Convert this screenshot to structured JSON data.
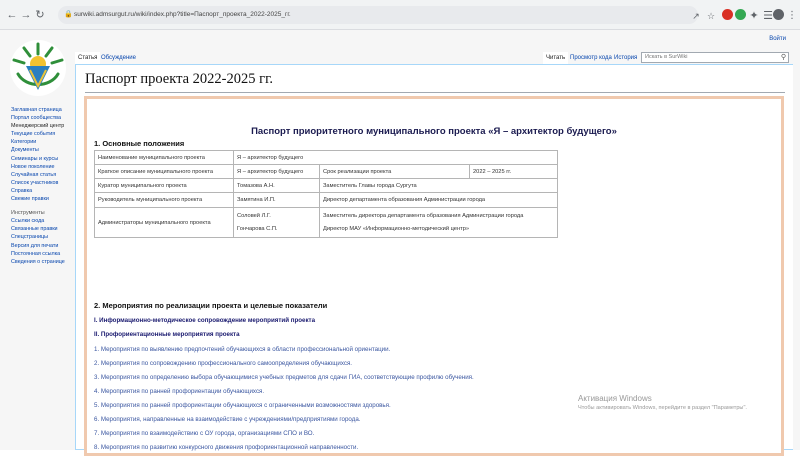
{
  "browser": {
    "url": "surwiki.admsurgut.ru/wiki/index.php?title=Паспорт_проекта_2022-2025_гг."
  },
  "top": {
    "login": "Войти"
  },
  "tabs": {
    "left": [
      "Статья",
      "Обсуждение"
    ],
    "right": [
      "Читать",
      "Просмотр кода",
      "История"
    ]
  },
  "search": {
    "placeholder": "Искать в SurWiki"
  },
  "sidebar": {
    "navigation": [
      "Заглавная страница",
      "Портал сообщества",
      "Менеджерский центр",
      "Текущие события",
      "Категории",
      "Документы",
      "Семинары и курсы",
      "Новое поколение",
      "Случайная статья",
      "Список участников",
      "Справка",
      "Свежие правки"
    ],
    "tools_header": "Инструменты",
    "tools": [
      "Ссылки сюда",
      "Связанные правки",
      "Спецстраницы",
      "Версия для печати",
      "Постоянная ссылка",
      "Сведения о странице"
    ]
  },
  "page": {
    "title": "Паспорт проекта 2022-2025 гг.",
    "doc_title": "Паспорт приоритетного муниципального проекта «Я – архитектор будущего»",
    "section1": "1. Основные положения",
    "table": {
      "r1": [
        "Наименование муниципального проекта",
        "Я – архитектор будущего"
      ],
      "r2": [
        "Краткое описание муниципального проекта",
        "Я – архитектор будущего",
        "Срок реализации проекта",
        "2022 – 2025 гг."
      ],
      "r3": [
        "Куратор муниципального проекта",
        "Томазова А.Н.",
        "Заместитель Главы города Сургута"
      ],
      "r4": [
        "Руководитель муниципального проекта",
        "Замятина И.П.",
        "Директор департамента образования Администрации города"
      ],
      "r5": [
        "Администраторы муниципального проекта",
        "Соловей Л.Г.",
        "Гончарова С.П.",
        "Заместитель директора департамента образования Администрации города",
        "Директор МАУ «Информационно-методический центр»"
      ]
    },
    "section2": "2. Мероприятия по реализации проекта и целевые показатели",
    "sub1": "I. Информационно-методическое сопровождение мероприятий проекта",
    "sub2": "II. Профориентационные мероприятия проекта",
    "items": [
      "1. Мероприятия по выявлению предпочтений обучающихся в области профессиональной ориентации.",
      "2. Мероприятия по сопровождению профессионального самоопределения обучающихся.",
      "3. Мероприятия по определению выбора обучающимися учебных предметов для сдачи ГИА, соответствующие профилю обучения.",
      "4. Мероприятия по ранней профориентации обучающихся.",
      "5. Мероприятия по ранней профориентации обучающихся с ограниченными возможностями здоровья.",
      "6. Мероприятия, направленные на взаимодействие с учреждениями/предприятиями города.",
      "7. Мероприятия по взаимодействию с ОУ города, организациями СПО и ВО.",
      "8. Мероприятия по развитию конкурсного движения профориентационной направленности."
    ]
  },
  "watermark": {
    "line1": "Активация Windows",
    "line2": "Чтобы активировать Windows, перейдите в раздел \"Параметры\"."
  }
}
